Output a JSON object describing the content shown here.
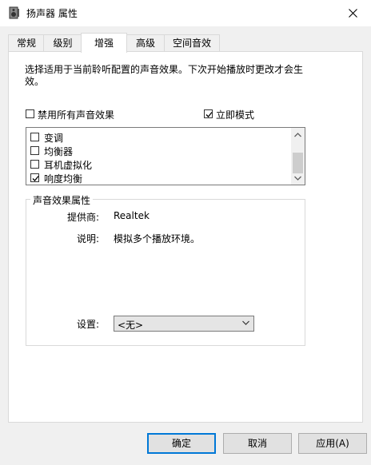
{
  "window": {
    "title": "扬声器 属性",
    "close_glyph": "✕"
  },
  "tabs": [
    {
      "label": "常规"
    },
    {
      "label": "级别"
    },
    {
      "label": "增强"
    },
    {
      "label": "高级"
    },
    {
      "label": "空间音效"
    }
  ],
  "enhancements": {
    "description": "选择适用于当前聆听配置的声音效果。下次开始播放时更改才会生效。",
    "disable_all": {
      "label": "禁用所有声音效果",
      "checked": false
    },
    "immediate_mode": {
      "label": "立即模式",
      "checked": true
    },
    "effects": [
      {
        "label": "变调",
        "checked": false
      },
      {
        "label": "均衡器",
        "checked": false
      },
      {
        "label": "耳机虚拟化",
        "checked": false
      },
      {
        "label": "响度均衡",
        "checked": true
      }
    ]
  },
  "properties": {
    "group_title": "声音效果属性",
    "provider_label": "提供商:",
    "provider_value": "Realtek",
    "desc_label": "说明:",
    "desc_value": "模拟多个播放环境。",
    "settings_label": "设置:",
    "settings_value": "<无>"
  },
  "buttons": {
    "ok": "确定",
    "cancel": "取消",
    "apply": "应用(A)"
  },
  "colors": {
    "accent": "#0078d7"
  }
}
